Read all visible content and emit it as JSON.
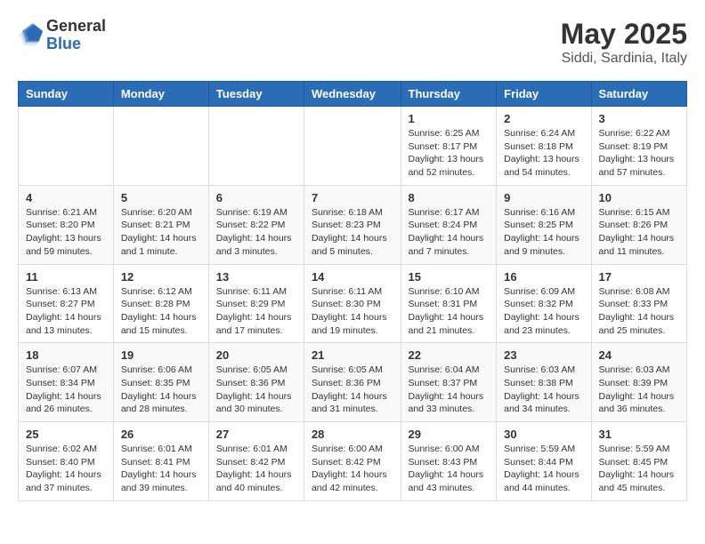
{
  "logo": {
    "general": "General",
    "blue": "Blue"
  },
  "title": "May 2025",
  "subtitle": "Siddi, Sardinia, Italy",
  "days_of_week": [
    "Sunday",
    "Monday",
    "Tuesday",
    "Wednesday",
    "Thursday",
    "Friday",
    "Saturday"
  ],
  "weeks": [
    [
      {
        "day": "",
        "info": ""
      },
      {
        "day": "",
        "info": ""
      },
      {
        "day": "",
        "info": ""
      },
      {
        "day": "",
        "info": ""
      },
      {
        "day": "1",
        "info": "Sunrise: 6:25 AM\nSunset: 8:17 PM\nDaylight: 13 hours\nand 52 minutes."
      },
      {
        "day": "2",
        "info": "Sunrise: 6:24 AM\nSunset: 8:18 PM\nDaylight: 13 hours\nand 54 minutes."
      },
      {
        "day": "3",
        "info": "Sunrise: 6:22 AM\nSunset: 8:19 PM\nDaylight: 13 hours\nand 57 minutes."
      }
    ],
    [
      {
        "day": "4",
        "info": "Sunrise: 6:21 AM\nSunset: 8:20 PM\nDaylight: 13 hours\nand 59 minutes."
      },
      {
        "day": "5",
        "info": "Sunrise: 6:20 AM\nSunset: 8:21 PM\nDaylight: 14 hours\nand 1 minute."
      },
      {
        "day": "6",
        "info": "Sunrise: 6:19 AM\nSunset: 8:22 PM\nDaylight: 14 hours\nand 3 minutes."
      },
      {
        "day": "7",
        "info": "Sunrise: 6:18 AM\nSunset: 8:23 PM\nDaylight: 14 hours\nand 5 minutes."
      },
      {
        "day": "8",
        "info": "Sunrise: 6:17 AM\nSunset: 8:24 PM\nDaylight: 14 hours\nand 7 minutes."
      },
      {
        "day": "9",
        "info": "Sunrise: 6:16 AM\nSunset: 8:25 PM\nDaylight: 14 hours\nand 9 minutes."
      },
      {
        "day": "10",
        "info": "Sunrise: 6:15 AM\nSunset: 8:26 PM\nDaylight: 14 hours\nand 11 minutes."
      }
    ],
    [
      {
        "day": "11",
        "info": "Sunrise: 6:13 AM\nSunset: 8:27 PM\nDaylight: 14 hours\nand 13 minutes."
      },
      {
        "day": "12",
        "info": "Sunrise: 6:12 AM\nSunset: 8:28 PM\nDaylight: 14 hours\nand 15 minutes."
      },
      {
        "day": "13",
        "info": "Sunrise: 6:11 AM\nSunset: 8:29 PM\nDaylight: 14 hours\nand 17 minutes."
      },
      {
        "day": "14",
        "info": "Sunrise: 6:11 AM\nSunset: 8:30 PM\nDaylight: 14 hours\nand 19 minutes."
      },
      {
        "day": "15",
        "info": "Sunrise: 6:10 AM\nSunset: 8:31 PM\nDaylight: 14 hours\nand 21 minutes."
      },
      {
        "day": "16",
        "info": "Sunrise: 6:09 AM\nSunset: 8:32 PM\nDaylight: 14 hours\nand 23 minutes."
      },
      {
        "day": "17",
        "info": "Sunrise: 6:08 AM\nSunset: 8:33 PM\nDaylight: 14 hours\nand 25 minutes."
      }
    ],
    [
      {
        "day": "18",
        "info": "Sunrise: 6:07 AM\nSunset: 8:34 PM\nDaylight: 14 hours\nand 26 minutes."
      },
      {
        "day": "19",
        "info": "Sunrise: 6:06 AM\nSunset: 8:35 PM\nDaylight: 14 hours\nand 28 minutes."
      },
      {
        "day": "20",
        "info": "Sunrise: 6:05 AM\nSunset: 8:36 PM\nDaylight: 14 hours\nand 30 minutes."
      },
      {
        "day": "21",
        "info": "Sunrise: 6:05 AM\nSunset: 8:36 PM\nDaylight: 14 hours\nand 31 minutes."
      },
      {
        "day": "22",
        "info": "Sunrise: 6:04 AM\nSunset: 8:37 PM\nDaylight: 14 hours\nand 33 minutes."
      },
      {
        "day": "23",
        "info": "Sunrise: 6:03 AM\nSunset: 8:38 PM\nDaylight: 14 hours\nand 34 minutes."
      },
      {
        "day": "24",
        "info": "Sunrise: 6:03 AM\nSunset: 8:39 PM\nDaylight: 14 hours\nand 36 minutes."
      }
    ],
    [
      {
        "day": "25",
        "info": "Sunrise: 6:02 AM\nSunset: 8:40 PM\nDaylight: 14 hours\nand 37 minutes."
      },
      {
        "day": "26",
        "info": "Sunrise: 6:01 AM\nSunset: 8:41 PM\nDaylight: 14 hours\nand 39 minutes."
      },
      {
        "day": "27",
        "info": "Sunrise: 6:01 AM\nSunset: 8:42 PM\nDaylight: 14 hours\nand 40 minutes."
      },
      {
        "day": "28",
        "info": "Sunrise: 6:00 AM\nSunset: 8:42 PM\nDaylight: 14 hours\nand 42 minutes."
      },
      {
        "day": "29",
        "info": "Sunrise: 6:00 AM\nSunset: 8:43 PM\nDaylight: 14 hours\nand 43 minutes."
      },
      {
        "day": "30",
        "info": "Sunrise: 5:59 AM\nSunset: 8:44 PM\nDaylight: 14 hours\nand 44 minutes."
      },
      {
        "day": "31",
        "info": "Sunrise: 5:59 AM\nSunset: 8:45 PM\nDaylight: 14 hours\nand 45 minutes."
      }
    ]
  ]
}
